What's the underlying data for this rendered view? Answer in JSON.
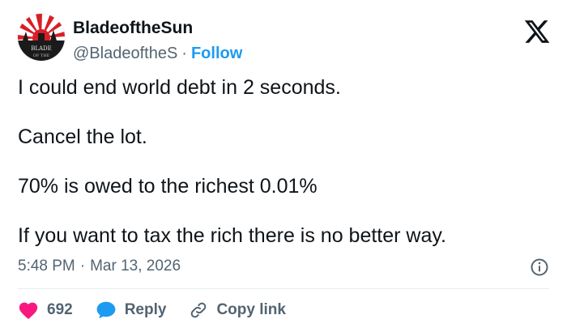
{
  "author": {
    "display_name": "BladeoftheSun",
    "handle": "@BladeoftheS",
    "separator": "·",
    "follow_label": "Follow",
    "avatar_text_line1": "BLADE",
    "avatar_text_line2": "OF THE"
  },
  "tweet": {
    "lines": [
      "I could end world debt in 2 seconds.",
      "Cancel the lot.",
      "70% is owed to the richest 0.01%",
      "If you want to tax the rich there is no better way."
    ]
  },
  "meta": {
    "time": "5:48 PM",
    "separator": "·",
    "date": "Mar 13, 2026"
  },
  "actions": {
    "likes_count": "692",
    "reply_label": "Reply",
    "copy_link_label": "Copy link"
  },
  "icons": {
    "brand": "x-logo-icon",
    "info": "info-icon",
    "like": "heart-icon",
    "reply": "speech-bubble-icon",
    "copy": "link-icon"
  },
  "colors": {
    "text_primary": "#0f1419",
    "text_secondary": "#536471",
    "accent_blue": "#1d9bf0",
    "like_pink": "#f91880",
    "avatar_red": "#d81f26"
  }
}
